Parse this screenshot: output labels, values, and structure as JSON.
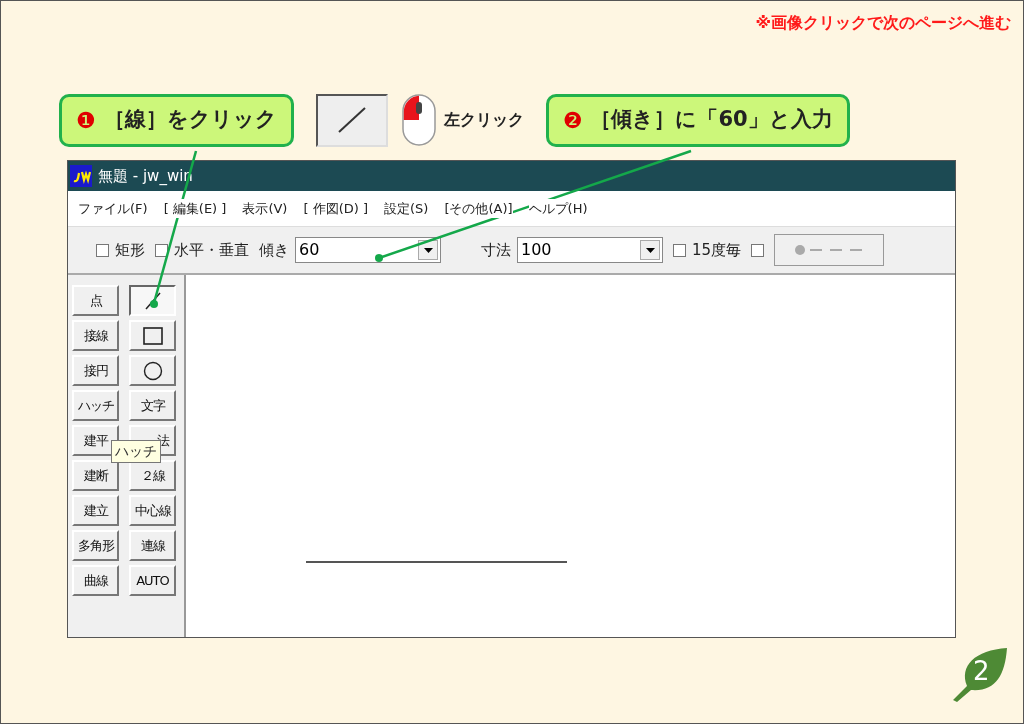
{
  "note": "※画像クリックで次のページへ進む",
  "callouts": [
    {
      "number": "❶",
      "text": "［線］をクリック"
    },
    {
      "number": "❷",
      "text": "［傾き］に「60」と入力"
    }
  ],
  "hint": {
    "text": "左クリック"
  },
  "window": {
    "title": "無題 - jw_win"
  },
  "menu": [
    "ファイル(F)",
    "[ 編集(E) ]",
    "表示(V)",
    "[ 作図(D) ]",
    "設定(S)",
    "[その他(A)]",
    "ヘルプ(H)"
  ],
  "toolbar": [
    {
      "kind": "checkbox",
      "label": "矩形",
      "checked": false
    },
    {
      "kind": "checkbox",
      "label": "水平・垂直",
      "checked": false
    },
    {
      "kind": "combo",
      "label": "傾き",
      "value": "60"
    },
    {
      "kind": "combo",
      "label": "寸法",
      "value": "100"
    },
    {
      "kind": "checkbox",
      "label": "15度毎",
      "checked": false
    },
    {
      "kind": "checkbox",
      "checked": false
    },
    {
      "kind": "line-style"
    }
  ],
  "tools": {
    "left": [
      {
        "kind": "text",
        "label": "点",
        "selected": false
      },
      {
        "kind": "text",
        "label": "接線",
        "selected": false
      },
      {
        "kind": "text",
        "label": "接円",
        "selected": false
      },
      {
        "kind": "text",
        "label": "ハッチ",
        "selected": false
      },
      {
        "kind": "text",
        "label": "建平",
        "selected": false
      },
      {
        "kind": "text",
        "label": "建断",
        "selected": false
      },
      {
        "kind": "text",
        "label": "建立",
        "selected": false
      },
      {
        "kind": "text",
        "label": "多角形",
        "selected": false
      },
      {
        "kind": "text",
        "label": "曲線",
        "selected": false
      }
    ],
    "right": [
      {
        "kind": "line",
        "selected": true
      },
      {
        "kind": "rect",
        "selected": false
      },
      {
        "kind": "circle",
        "selected": false
      },
      {
        "kind": "text",
        "label": "文字",
        "selected": false
      },
      {
        "kind": "clipped-text",
        "label": "法",
        "selected": false
      },
      {
        "kind": "text",
        "label": "２線",
        "selected": false
      },
      {
        "kind": "text",
        "label": "中心線",
        "selected": false
      },
      {
        "kind": "text",
        "label": "連線",
        "selected": false
      },
      {
        "kind": "text",
        "label": "AUTO",
        "selected": false
      }
    ]
  },
  "tooltip": "ハッチ",
  "page_number": "2"
}
